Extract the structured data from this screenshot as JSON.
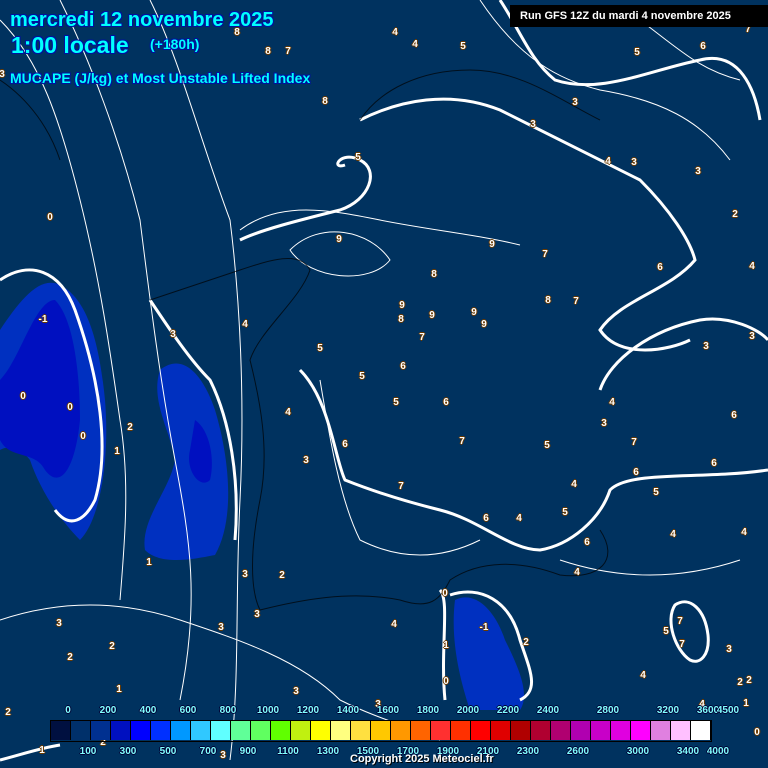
{
  "header": {
    "date": "mercredi 12 novembre 2025",
    "time": "1:00 locale",
    "lead": "(+180h)",
    "parameter": "MUCAPE (J/kg) et Most Unstable Lifted Index"
  },
  "run_info": "Run GFS 12Z du mardi 4 novembre 2025",
  "copyright": "Copyright 2025 Meteociel.fr",
  "colors": {
    "background": "#00325f",
    "cape_low": "#0030c0",
    "cape_mid": "#0010c0",
    "contour": "#ffffff",
    "title": "#00ffff"
  },
  "legend": {
    "top_labels": [
      "0",
      "200",
      "400",
      "600",
      "800",
      "1000",
      "1200",
      "1400",
      "1600",
      "1800",
      "2000",
      "2200",
      "2400",
      "2800",
      "3200",
      "3600",
      "4500"
    ],
    "bottom_labels": [
      "100",
      "300",
      "500",
      "700",
      "900",
      "1100",
      "1300",
      "1500",
      "1700",
      "1900",
      "2100",
      "2300",
      "2600",
      "3000",
      "3400",
      "4000"
    ],
    "swatches": [
      "#001040",
      "#00306a",
      "#003090",
      "#0010c0",
      "#0000ff",
      "#0030ff",
      "#0098ff",
      "#30c8ff",
      "#60ffff",
      "#60ff98",
      "#60ff60",
      "#60ff00",
      "#c0f010",
      "#ffff00",
      "#ffff80",
      "#ffe040",
      "#ffc800",
      "#ff9800",
      "#ff6400",
      "#ff3030",
      "#ff3000",
      "#ff0000",
      "#e00000",
      "#b00000",
      "#b00030",
      "#b00070",
      "#b000b0",
      "#c800c8",
      "#e000e0",
      "#ff00ff",
      "#e080e0",
      "#ffc0ff",
      "#ffffff"
    ]
  },
  "lifted_index_labels": [
    "8",
    "8",
    "7",
    "4",
    "4",
    "5",
    "6",
    "5",
    "7",
    "3",
    "3",
    "5",
    "4",
    "3",
    "3",
    "8",
    "3",
    "0",
    "2",
    "9",
    "9",
    "7",
    "6",
    "4",
    "8",
    "8",
    "7",
    "9",
    "8",
    "9",
    "9",
    "9",
    "7",
    "4",
    "3",
    "-1",
    "5",
    "3",
    "3",
    "6",
    "5",
    "5",
    "6",
    "4",
    "0",
    "0",
    "0",
    "2",
    "1",
    "6",
    "7",
    "5",
    "4",
    "3",
    "7",
    "6",
    "6",
    "6",
    "3",
    "7",
    "5",
    "4",
    "6",
    "4",
    "5",
    "4",
    "4",
    "6",
    "4",
    "1",
    "3",
    "2",
    "0",
    "3",
    "3",
    "3",
    "4",
    "-1",
    "2",
    "2",
    "1",
    "2",
    "5",
    "7",
    "7",
    "3",
    "1",
    "3",
    "0",
    "4",
    "2",
    "2",
    "1",
    "2",
    "3",
    "4",
    "0",
    "1",
    "2",
    "3"
  ]
}
